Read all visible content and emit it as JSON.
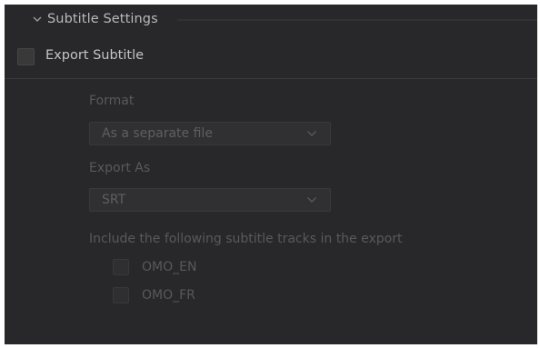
{
  "section": {
    "title": "Subtitle Settings",
    "chevron_icon": "chevron-down-icon"
  },
  "export_subtitle": {
    "label": "Export Subtitle",
    "checked": false
  },
  "format": {
    "label": "Format",
    "value": "As a separate file",
    "arrow_icon": "chevron-down-icon"
  },
  "export_as": {
    "label": "Export As",
    "value": "SRT",
    "arrow_icon": "chevron-down-icon"
  },
  "tracks": {
    "label": "Include the following subtitle tracks in the export",
    "items": [
      {
        "label": "OMO_EN",
        "checked": false
      },
      {
        "label": "OMO_FR",
        "checked": false
      }
    ]
  },
  "colors": {
    "panel_background": "#28282a",
    "text_enabled": "#c4c4c6",
    "text_disabled": "#59595c"
  }
}
